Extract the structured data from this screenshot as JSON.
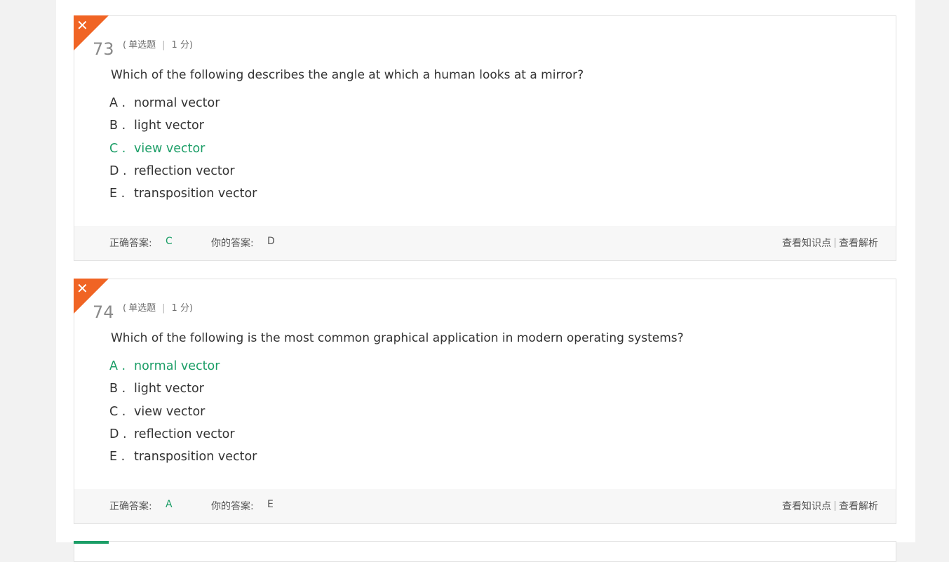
{
  "colors": {
    "wrong_corner": "#f06424",
    "correct_green": "#1c9e67",
    "text": "#333333"
  },
  "labels": {
    "correct_answer": "正确答案:",
    "your_answer": "你的答案:",
    "view_knowledge": "查看知识点",
    "view_analysis": "查看解析"
  },
  "questions": [
    {
      "number": "73",
      "status_icon": "close-icon",
      "type": "单选题",
      "score": "1",
      "score_unit": "分",
      "text": "Which of the following describes the angle at which a human looks at a mirror?",
      "options": [
        {
          "letter": "A .",
          "text": "normal vector"
        },
        {
          "letter": "B .",
          "text": "light vector"
        },
        {
          "letter": "C .",
          "text": "view vector"
        },
        {
          "letter": "D .",
          "text": "reflection vector"
        },
        {
          "letter": "E .",
          "text": "transposition vector"
        }
      ],
      "correct": "C",
      "yours": "D"
    },
    {
      "number": "74",
      "status_icon": "close-icon",
      "type": "单选题",
      "score": "1",
      "score_unit": "分",
      "text": "Which of the following is the most common graphical application in modern operating systems?",
      "options": [
        {
          "letter": "A .",
          "text": "normal vector"
        },
        {
          "letter": "B .",
          "text": "light vector"
        },
        {
          "letter": "C .",
          "text": "view vector"
        },
        {
          "letter": "D .",
          "text": "reflection vector"
        },
        {
          "letter": "E .",
          "text": "transposition vector"
        }
      ],
      "correct": "A",
      "yours": "E"
    }
  ]
}
